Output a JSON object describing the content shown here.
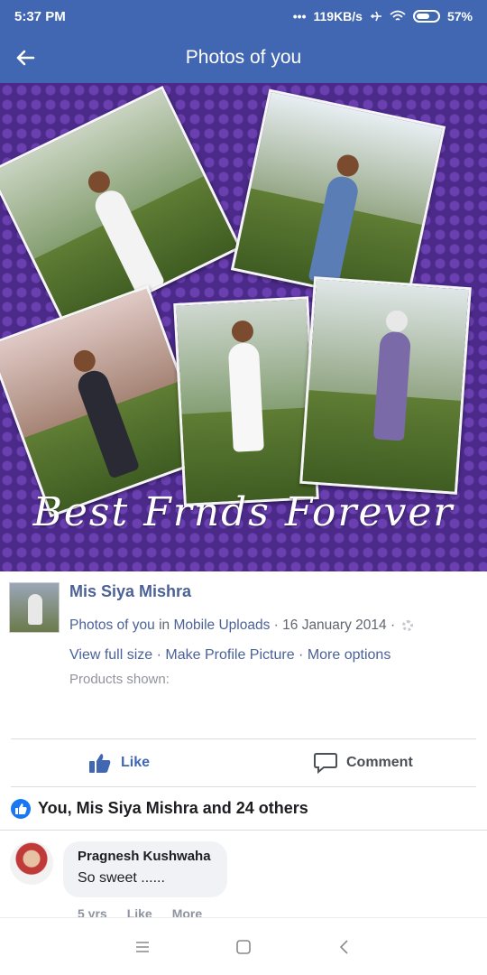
{
  "status_bar": {
    "time": "5:37 PM",
    "dots": "•••",
    "network_speed": "119KB/s",
    "battery": "57%"
  },
  "app_bar": {
    "title": "Photos of you",
    "back_icon": "arrow-left-icon"
  },
  "photo": {
    "caption": "Best Frnds Forever"
  },
  "post": {
    "author": "Mis Siya Mishra",
    "album_label": "Photos of you",
    "in_word": "in",
    "album_name": "Mobile Uploads",
    "separator": "·",
    "date": "16 January 2014",
    "privacy_icon": "gear-icon",
    "options": [
      "View full size",
      "Make Profile Picture",
      "More options"
    ],
    "products_shown": "Products shown:"
  },
  "actions": {
    "like_label": "Like",
    "comment_label": "Comment"
  },
  "reactions": {
    "summary": "You, Mis Siya Mishra and 24 others"
  },
  "comment": {
    "author": "Pragnesh Kushwaha",
    "text": "So sweet ......",
    "time": "5 yrs",
    "like_label": "Like",
    "more_label": "More"
  },
  "colors": {
    "brand": "#4267b2",
    "link": "#4b6297",
    "photo_background": "#4b2a8a"
  }
}
